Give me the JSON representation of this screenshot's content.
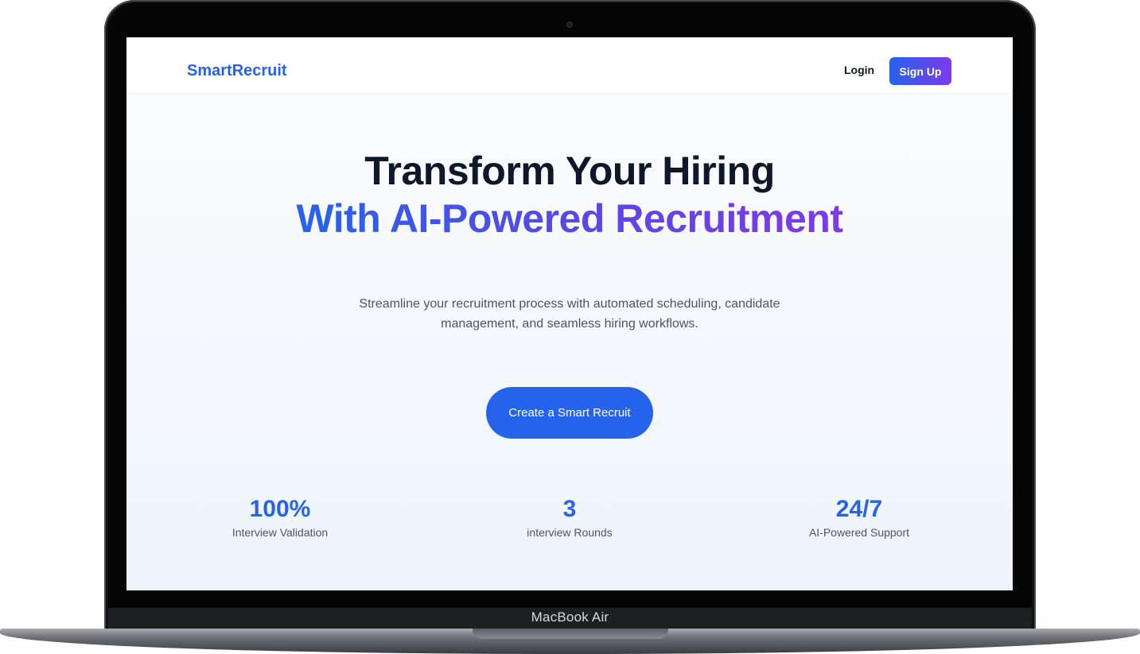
{
  "device": {
    "model_label": "MacBook Air"
  },
  "nav": {
    "brand": "SmartRecruit",
    "login_label": "Login",
    "signup_label": "Sign Up"
  },
  "hero": {
    "title_line1": "Transform Your Hiring",
    "title_line2": "With AI-Powered Recruitment",
    "subtitle": "Streamline your recruitment process with automated scheduling, candidate management, and seamless hiring workflows.",
    "cta_label": "Create a Smart Recruit"
  },
  "stats": [
    {
      "value": "100%",
      "label": "Interview Validation"
    },
    {
      "value": "3",
      "label": "interview Rounds"
    },
    {
      "value": "24/7",
      "label": "AI-Powered Support"
    }
  ],
  "colors": {
    "brand_blue": "#2563eb",
    "accent_purple": "#7c3aed",
    "heading_dark": "#0f172a",
    "body_gray": "#4b5563"
  }
}
